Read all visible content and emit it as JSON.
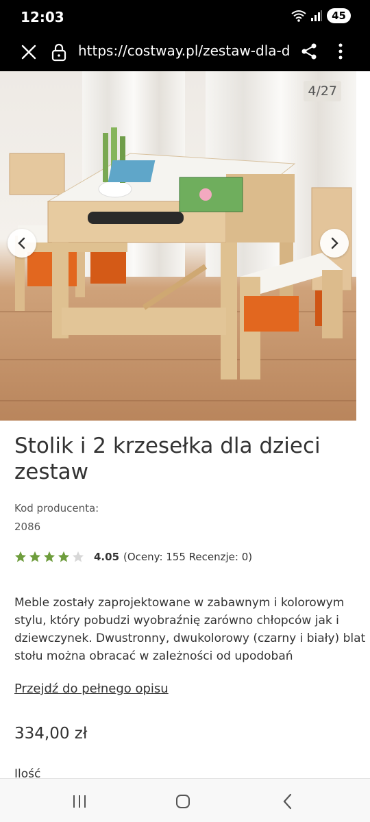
{
  "status_bar": {
    "time": "12:03",
    "battery": "45"
  },
  "browser": {
    "url": "https://costway.pl/zestaw-dla-dz"
  },
  "gallery": {
    "counter": "4/27"
  },
  "product": {
    "title": "Stolik i 2 krzesełka dla dzieci zestaw",
    "code_label": "Kod producenta:",
    "code_value": "2086",
    "rating_value": "4.05",
    "rating_meta": "(Oceny: 155 Recenzje: 0)",
    "rating_stars": 4.05,
    "description": "Meble zostały zaprojektowane w zabawnym i kolorowym stylu, który pobudzi wyobraźnię zarówno chłopców jak i dziewczynek. Dwustronny, dwukolorowy (czarny i biały) blat stołu można obracać w zależności od upodobań",
    "full_description_link": "Przejdź do pełnego opisu",
    "price": "334,00 zł",
    "quantity_label": "Ilość"
  },
  "colors": {
    "star_filled": "#6e9d3c",
    "star_empty": "#d7d7d7",
    "accent_orange": "#e2671f",
    "wood": "#e3c49a"
  }
}
